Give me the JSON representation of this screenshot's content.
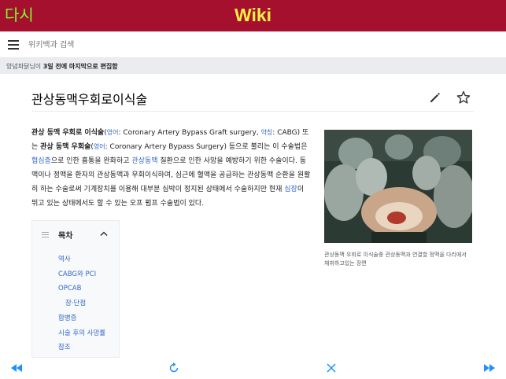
{
  "topbar": {
    "back_label": "다시",
    "title": "Wiki",
    "back_color": "#7dff2a",
    "title_color": "#ffee44",
    "bg_color": "#a4102d"
  },
  "search": {
    "placeholder": "위키백과 검색"
  },
  "edit_notice": {
    "prefix": "양념파닭님이 ",
    "bold": "3일 전에 마지막으로 편집함"
  },
  "article": {
    "title": "관상동맥우회로이식술",
    "intro": {
      "p1": "관상 동맥 우회로 이식술",
      "p2": "(",
      "p3": "영어",
      "p4": ": Coronary Artery Bypass Graft surgery, ",
      "p5": "약칭",
      "p6": ": CABG) 또는 ",
      "p7": "관상 동맥 우회술",
      "p8": "(",
      "p9": "영어",
      "p10": ": Coronary Artery Bypass Surgery) 등으로 불리는 이 수술법은 ",
      "p11": "협심증",
      "p12": "으로 인한 흉통을 완화하고 ",
      "p13": "관상동맥",
      "p14": " 질환으로 인한 사망을 예방하기 위한 수술이다. 동맥이나 정맥을 환자의 관상동맥과 우회이식하여, 심근에 혈액을 공급하는 관상동맥 순환을 원활히 하는 수술로써 기계장치를 이용해 대부분 심박이 정지된 상태에서 수술하지만 현재 ",
      "p15": "심장",
      "p16": "이 뛰고 있는 상태에서도 할 수 있는 오프 펌프 수술법이 있다."
    },
    "image_caption": "관상동맥 우회로 이식술중 관상동맥과 연결할 정맥을 다리에서 채취하고있는 장면"
  },
  "toc": {
    "title": "목차",
    "items": [
      {
        "label": "역사"
      },
      {
        "label": "CABG와 PCI"
      },
      {
        "label": "OPCAB"
      },
      {
        "label": "장·단점"
      },
      {
        "label": "합병증"
      },
      {
        "label": "시술 후의 사망률"
      },
      {
        "label": "참조"
      }
    ]
  },
  "toolbar": {
    "icons": [
      "rewind-icon",
      "refresh-icon",
      "close-icon",
      "fast-forward-icon"
    ],
    "icon_color": "#1e90ff"
  }
}
